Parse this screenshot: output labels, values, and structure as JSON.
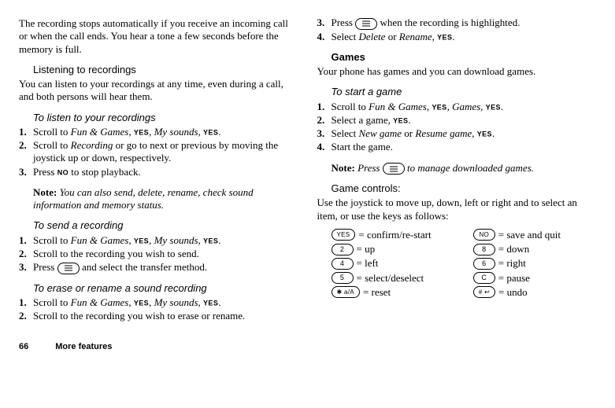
{
  "left": {
    "intro": "The recording stops automatically if you receive an incoming call or when the call ends. You hear a tone a few seconds before the memory is full.",
    "listen_title": "Listening to recordings",
    "listen_para": "You can listen to your recordings at any time, even during a call, and both persons will hear them.",
    "to_listen_title": "To listen to your recordings",
    "steps_listen": {
      "n1": "1.",
      "t1a": "Scroll to ",
      "t1b": "Fun & Games",
      "t1c": ", ",
      "t1d": ", ",
      "t1e": "My sounds",
      "t1f": ", ",
      "t1g": ".",
      "n2": "2.",
      "t2a": "Scroll to ",
      "t2b": "Recording",
      "t2c": " or go to next or previous by moving the joystick up or down, respectively.",
      "n3": "3.",
      "t3a": "Press ",
      "t3b": " to stop playback."
    },
    "note_label": "Note:",
    "note_text": " You can also send, delete, rename, check sound information and memory status.",
    "to_send_title": "To send a recording",
    "steps_send": {
      "n1": "1.",
      "t1a": "Scroll to ",
      "t1b": "Fun & Games",
      "t1c": ", ",
      "t1d": ", ",
      "t1e": "My sounds",
      "t1f": ", ",
      "t1g": ".",
      "n2": "2.",
      "t2": "Scroll to the recording you wish to send.",
      "n3": "3.",
      "t3a": "Press ",
      "t3b": " and select the transfer method."
    },
    "to_erase_title": "To erase or rename a sound recording",
    "steps_erase": {
      "n1": "1.",
      "t1a": "Scroll to ",
      "t1b": "Fun & Games",
      "t1c": ", ",
      "t1d": ", ",
      "t1e": "My sounds",
      "t1f": ", ",
      "t1g": ".",
      "n2": "2.",
      "t2": "Scroll to the recording you wish to erase or rename."
    }
  },
  "right": {
    "steps_top": {
      "n3": "3.",
      "t3a": "Press ",
      "t3b": " when the recording is highlighted.",
      "n4": "4.",
      "t4a": "Select ",
      "t4b": "Delete",
      "t4c": " or ",
      "t4d": "Rename",
      "t4e": ", ",
      "t4f": "."
    },
    "games_title": "Games",
    "games_para": "Your phone has games and you can download games.",
    "to_start_title": "To start a game",
    "steps_start": {
      "n1": "1.",
      "t1a": "Scroll to ",
      "t1b": "Fun & Games",
      "t1c": ", ",
      "t1d": ", ",
      "t1e": "Games",
      "t1f": ", ",
      "t1g": ".",
      "n2": "2.",
      "t2a": "Select a game, ",
      "t2b": ".",
      "n3": "3.",
      "t3a": "Select ",
      "t3b": "New game",
      "t3c": " or ",
      "t3d": "Resume game",
      "t3e": ", ",
      "t3f": ".",
      "n4": "4.",
      "t4": "Start the game."
    },
    "note_label": "Note:",
    "note_mid": " Press ",
    "note_end": " to manage downloaded games.",
    "controls_title": "Game controls:",
    "controls_para": "Use the joystick to move up, down, left or right and to select an item, or use the keys as follows:",
    "keys": {
      "yes": "YES",
      "no": "NO",
      "k2": "2",
      "k8": "8",
      "k4": "4",
      "k6": "6",
      "k5": "5",
      "kc": "C",
      "star": "✱ a/A",
      "hash": "# ↩"
    },
    "labels": {
      "confirm": " = confirm/re-start",
      "save": " = save and quit",
      "up": " = up",
      "down": " = down",
      "left": " = left",
      "right": " = right",
      "select": " = select/deselect",
      "pause": " = pause",
      "reset": " = reset",
      "undo": " = undo"
    }
  },
  "yes": "YES",
  "no": "NO",
  "footer": {
    "page": "66",
    "title": "More features"
  }
}
